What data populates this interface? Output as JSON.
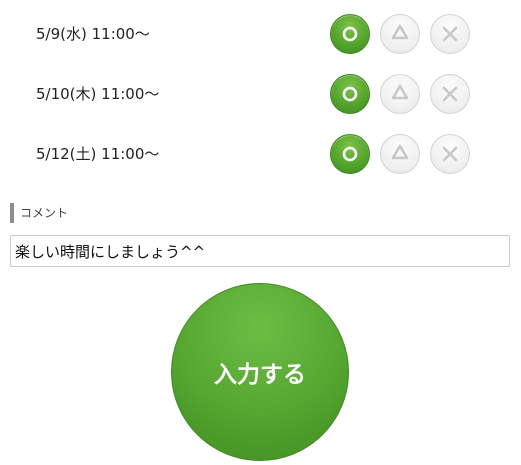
{
  "schedule": {
    "rows": [
      {
        "date_label": "5/9(水) 11:00〜",
        "selected": "yes"
      },
      {
        "date_label": "5/10(木) 11:00〜",
        "selected": "yes"
      },
      {
        "date_label": "5/12(土) 11:00〜",
        "selected": "yes"
      }
    ],
    "options": [
      {
        "key": "yes",
        "icon": "circle-icon"
      },
      {
        "key": "maybe",
        "icon": "triangle-icon"
      },
      {
        "key": "no",
        "icon": "cross-icon"
      }
    ]
  },
  "comment": {
    "label": "コメント",
    "value": "楽しい時間にしましょう^^"
  },
  "submit": {
    "label": "入力する"
  },
  "colors": {
    "accent_green": "#55a531",
    "inactive_gray": "#f1f1f1",
    "inactive_icon": "#c8c8c8"
  }
}
